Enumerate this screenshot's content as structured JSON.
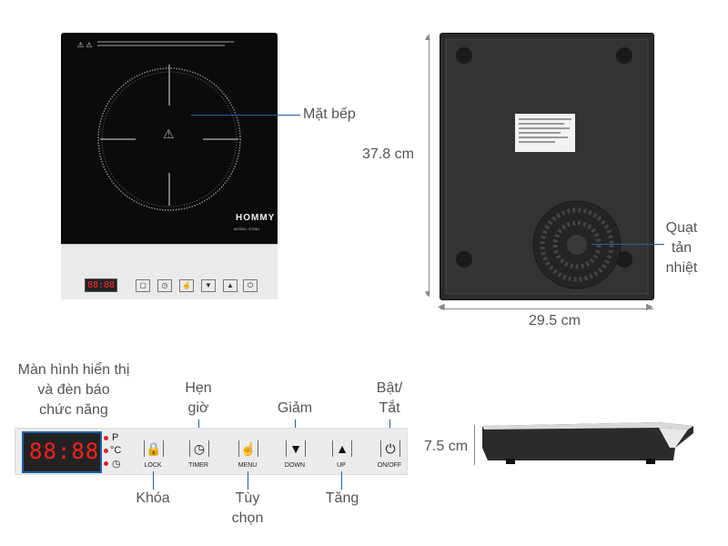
{
  "top_labels": {
    "surface": "Mặt bếp",
    "height": "37.8 cm",
    "fan_line1": "Quạt",
    "fan_line2": "tản",
    "fan_line3": "nhiệt",
    "width": "29.5 cm",
    "depth": "7.5 cm"
  },
  "brand": {
    "name": "HOMMY",
    "model": "MODEL: KT861"
  },
  "panel": {
    "display": "88:88",
    "indicators": [
      "P",
      "°C",
      "◷"
    ],
    "buttons": [
      {
        "name": "lock",
        "symbol": "🔒",
        "caption": "LOCK"
      },
      {
        "name": "timer",
        "symbol": "◷",
        "caption": "TIMER"
      },
      {
        "name": "menu",
        "symbol": "☝",
        "caption": "MENU"
      },
      {
        "name": "down",
        "symbol": "▼",
        "caption": "DOWN"
      },
      {
        "name": "up",
        "symbol": "▲",
        "caption": "UP"
      },
      {
        "name": "onoff",
        "symbol": "⏻",
        "caption": "ON/OFF"
      }
    ]
  },
  "callouts": {
    "display_line1": "Màn hình hiển thị",
    "display_line2": "và đèn báo",
    "display_line3": "chức năng",
    "timer_line1": "Hẹn",
    "timer_line2": "giờ",
    "down": "Giảm",
    "onoff_line1": "Bật/",
    "onoff_line2": "Tắt",
    "lock": "Khóa",
    "menu_line1": "Tùy",
    "menu_line2": "chọn",
    "up": "Tăng"
  },
  "colors": {
    "accent_line": "#1f5fa8",
    "segment_red": "#ff2020"
  }
}
